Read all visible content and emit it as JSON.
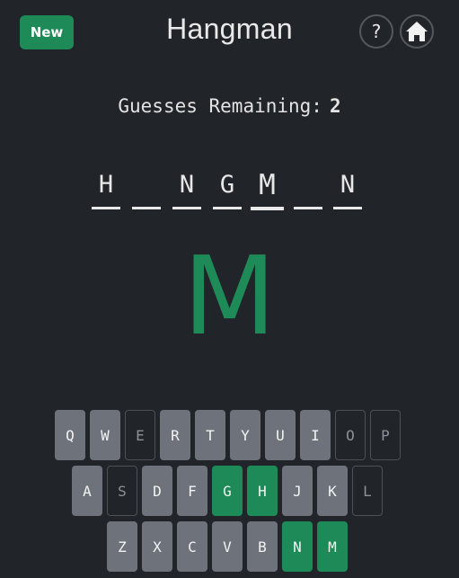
{
  "header": {
    "new_label": "New",
    "title": "Hangman",
    "help_label": "?",
    "home_icon": "home-icon"
  },
  "status": {
    "guesses_label": "Guesses Remaining:",
    "guesses_remaining": "2"
  },
  "word": {
    "slots": [
      "H",
      "",
      "N",
      "G",
      "M",
      "",
      "N"
    ],
    "current_index": 4
  },
  "last_guess": "M",
  "colors": {
    "background": "#212429",
    "accent": "#1e8a57",
    "key_unused": "#6e737b"
  },
  "keyboard": {
    "rows": [
      [
        {
          "letter": "Q",
          "state": "unused"
        },
        {
          "letter": "W",
          "state": "unused"
        },
        {
          "letter": "E",
          "state": "wrong"
        },
        {
          "letter": "R",
          "state": "unused"
        },
        {
          "letter": "T",
          "state": "unused"
        },
        {
          "letter": "Y",
          "state": "unused"
        },
        {
          "letter": "U",
          "state": "unused"
        },
        {
          "letter": "I",
          "state": "unused"
        },
        {
          "letter": "O",
          "state": "wrong"
        },
        {
          "letter": "P",
          "state": "wrong"
        }
      ],
      [
        {
          "letter": "A",
          "state": "unused"
        },
        {
          "letter": "S",
          "state": "wrong"
        },
        {
          "letter": "D",
          "state": "unused"
        },
        {
          "letter": "F",
          "state": "unused"
        },
        {
          "letter": "G",
          "state": "correct"
        },
        {
          "letter": "H",
          "state": "correct"
        },
        {
          "letter": "J",
          "state": "unused"
        },
        {
          "letter": "K",
          "state": "unused"
        },
        {
          "letter": "L",
          "state": "wrong"
        }
      ],
      [
        {
          "letter": "Z",
          "state": "unused"
        },
        {
          "letter": "X",
          "state": "unused"
        },
        {
          "letter": "C",
          "state": "unused"
        },
        {
          "letter": "V",
          "state": "unused"
        },
        {
          "letter": "B",
          "state": "unused"
        },
        {
          "letter": "N",
          "state": "correct"
        },
        {
          "letter": "M",
          "state": "correct"
        }
      ]
    ]
  }
}
